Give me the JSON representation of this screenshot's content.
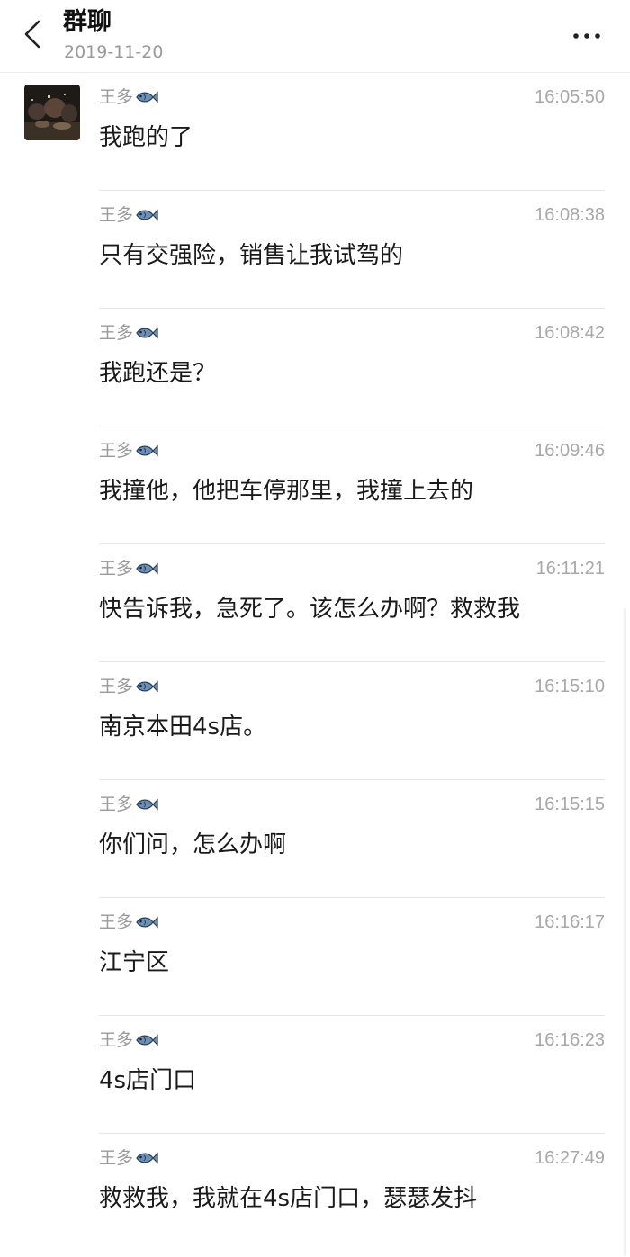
{
  "header": {
    "title": "群聊",
    "date": "2019-11-20",
    "back_icon": "chevron-left-icon",
    "more_icon": "more-horizontal-icon"
  },
  "messages": [
    {
      "sender": "王多",
      "time": "16:05:50",
      "text": "我跑的了"
    },
    {
      "sender": "王多",
      "time": "16:08:38",
      "text": "只有交强险，销售让我试驾的"
    },
    {
      "sender": "王多",
      "time": "16:08:42",
      "text": "我跑还是？"
    },
    {
      "sender": "王多",
      "time": "16:09:46",
      "text": "我撞他，他把车停那里，我撞上去的"
    },
    {
      "sender": "王多",
      "time": "16:11:21",
      "text": "快告诉我，急死了。该怎么办啊？救救我"
    },
    {
      "sender": "王多",
      "time": "16:15:10",
      "text": "南京本田4s店。"
    },
    {
      "sender": "王多",
      "time": "16:15:15",
      "text": "你们问，怎么办啊"
    },
    {
      "sender": "王多",
      "time": "16:16:17",
      "text": "江宁区"
    },
    {
      "sender": "王多",
      "time": "16:16:23",
      "text": "4s店门口"
    },
    {
      "sender": "王多",
      "time": "16:27:49",
      "text": "救救我，我就在4s店门口，瑟瑟发抖"
    }
  ],
  "colors": {
    "fish_body": "#6b8fb5",
    "fish_outline": "#2c3e55",
    "text_secondary": "#9a9a9a"
  }
}
